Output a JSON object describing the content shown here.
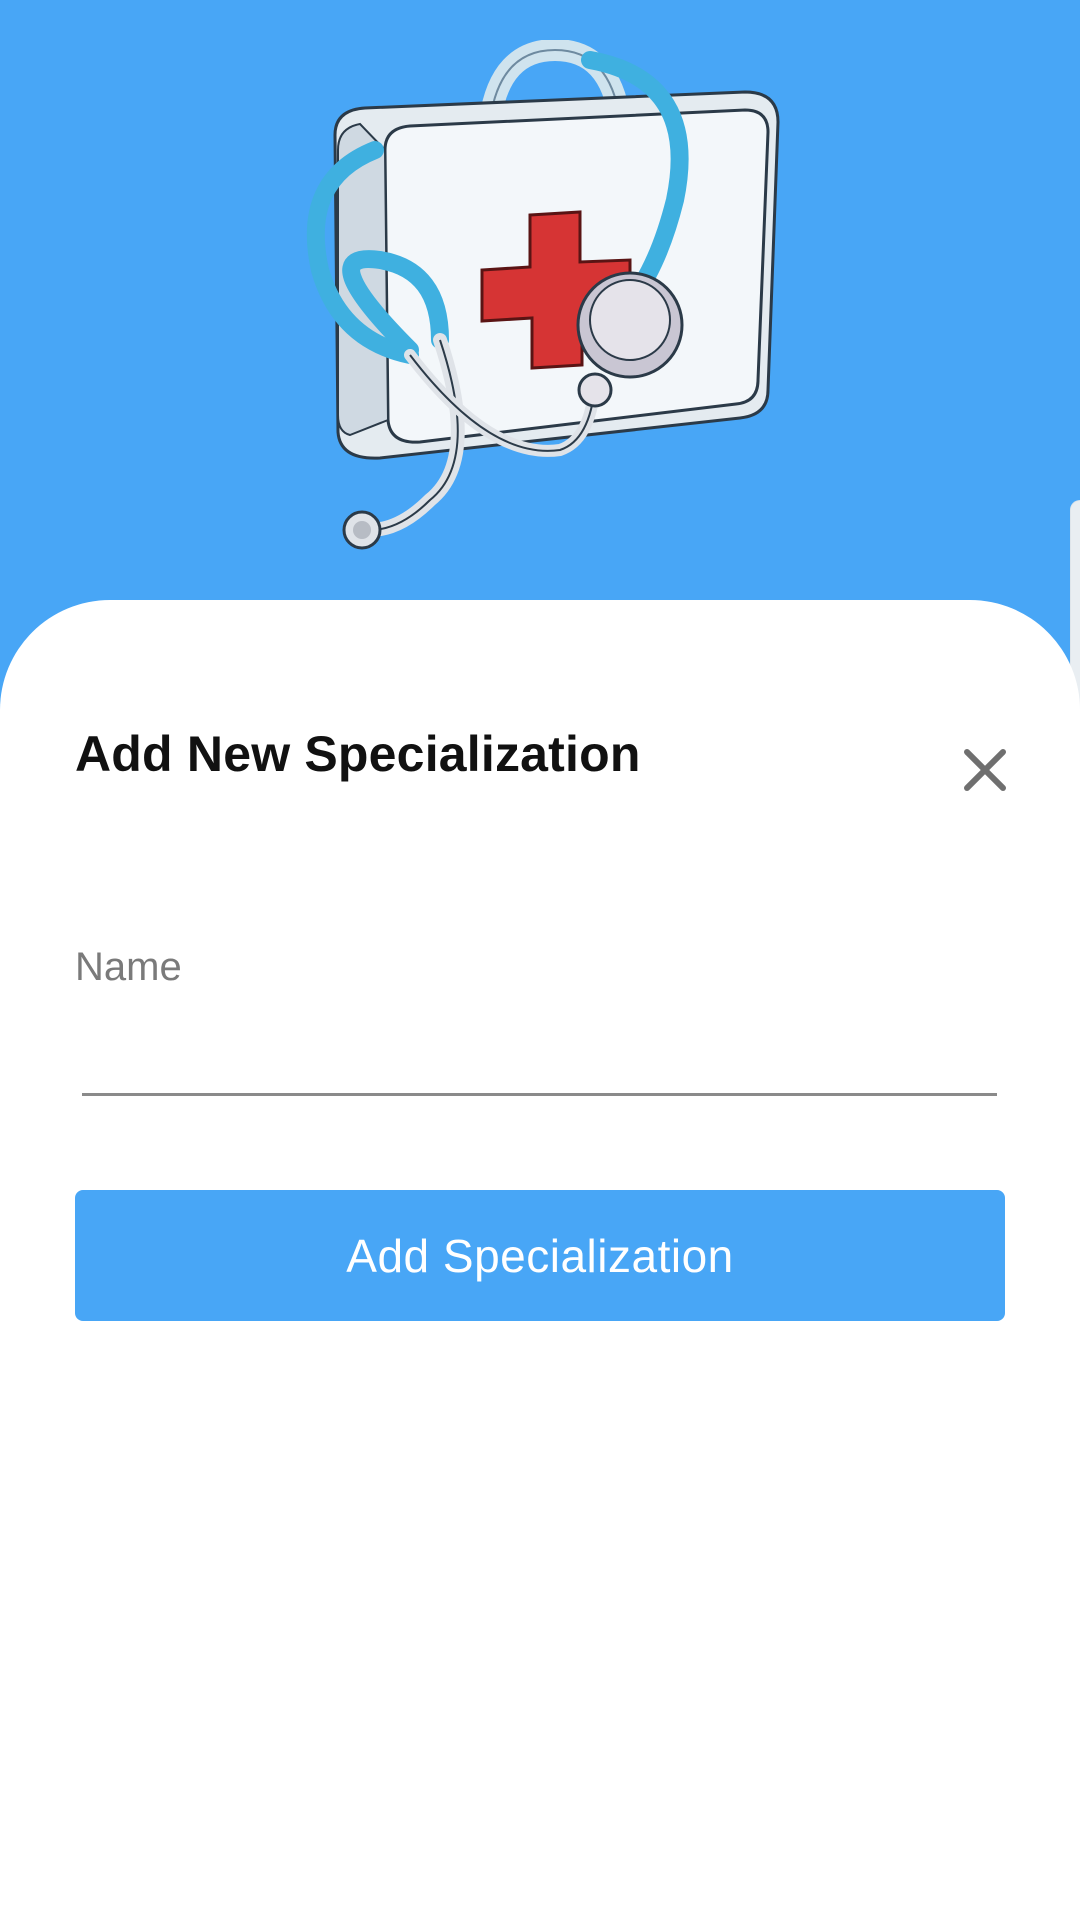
{
  "colors": {
    "header_background": "#48a6f6",
    "sheet_background": "#ffffff",
    "button_background": "#48a6f6",
    "button_text": "#ffffff",
    "title_text": "#111111",
    "label_text": "#7a7a7a",
    "close_icon": "#6f6f6f",
    "cross": "#d63434",
    "stethoscope": "#3fb0e0"
  },
  "header": {
    "illustration_icon": "medical-kit-stethoscope-icon"
  },
  "sheet": {
    "title": "Add New Specialization",
    "close_icon": "close-icon",
    "name_field": {
      "label": "Name",
      "value": "",
      "placeholder": ""
    },
    "submit_label": "Add Specialization"
  }
}
